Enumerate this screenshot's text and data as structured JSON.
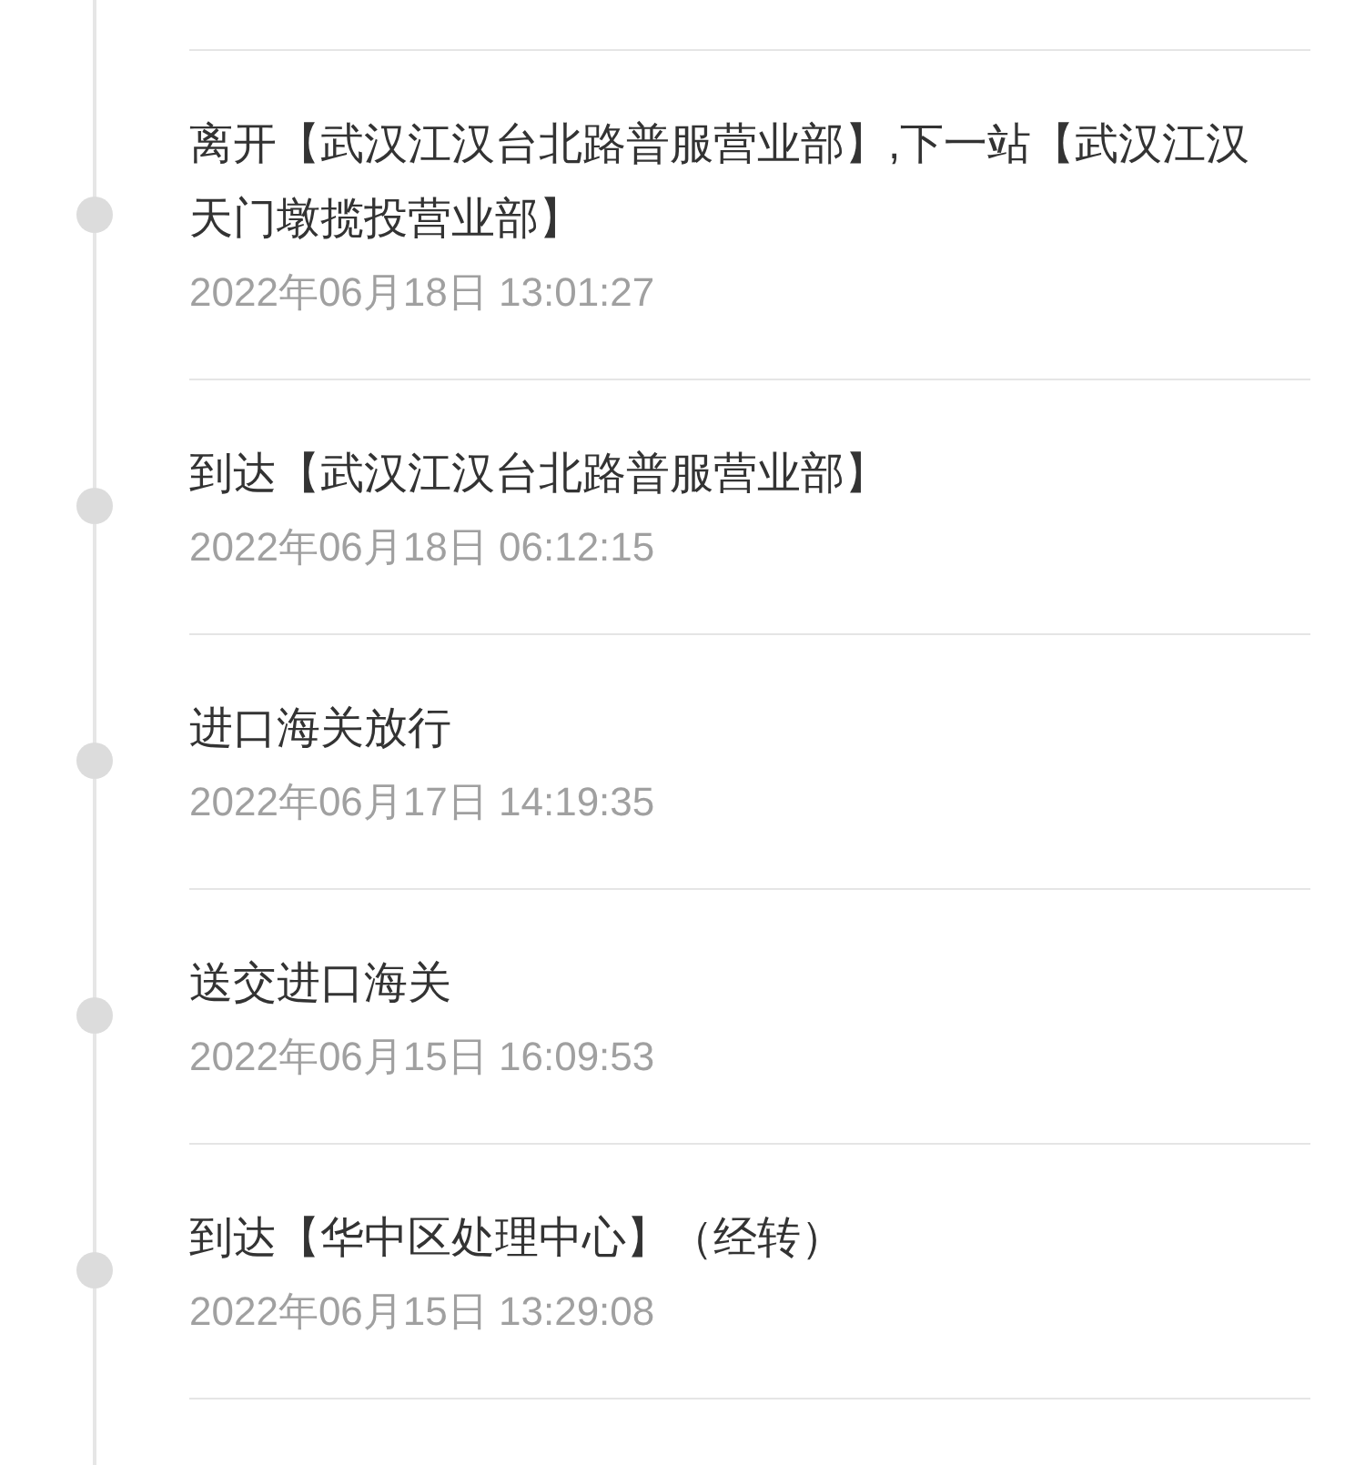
{
  "events": [
    {
      "title": "离开【武汉江汉台北路普服营业部】,下一站【武汉江汉天门墩揽投营业部】",
      "time": "2022年06月18日 13:01:27"
    },
    {
      "title": "到达【武汉江汉台北路普服营业部】",
      "time": "2022年06月18日 06:12:15"
    },
    {
      "title": "进口海关放行",
      "time": "2022年06月17日 14:19:35"
    },
    {
      "title": "送交进口海关",
      "time": "2022年06月15日 16:09:53"
    },
    {
      "title": "到达【华中区处理中心】（经转）",
      "time": "2022年06月15日 13:29:08"
    }
  ]
}
